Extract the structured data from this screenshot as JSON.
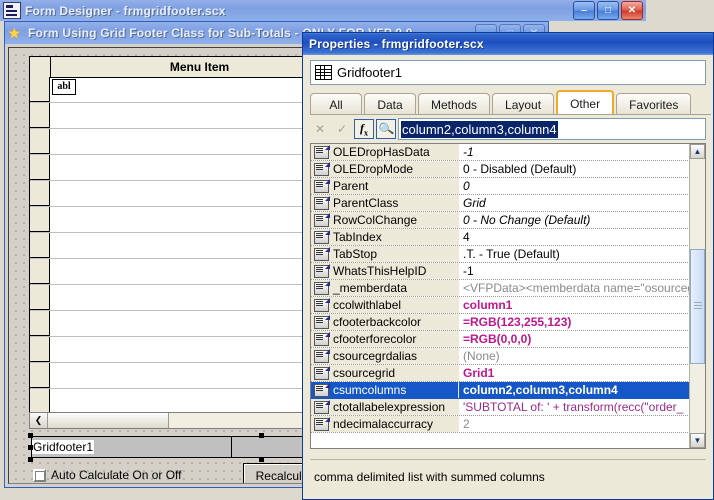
{
  "form_designer_window": {
    "title": "Form Designer - frmgridfooter.scx",
    "icon": "form-designer-icon",
    "buttons": {
      "minimize": "–",
      "maximize": "□",
      "close": "✕"
    }
  },
  "form_window": {
    "title": "Form Using Grid Footer Class for Sub-Totals - ONLY FOR VFP 9.0",
    "icon": "vfp-star-icon",
    "buttons": {
      "minimize": "–",
      "maximize": "□",
      "close": "✕"
    },
    "grid": {
      "headers": [
        "",
        "Menu Item",
        "",
        ""
      ],
      "textbox_glyph": "abl",
      "row_count": 13
    },
    "hscrollbar": {
      "left_arrow": "❮"
    },
    "footer_strip": {
      "label": "Gridfooter1"
    },
    "checkbox": {
      "label": "Auto Calculate On or Off",
      "checked": false
    },
    "recalc_button": {
      "label": "Recalculate",
      "accel": "R"
    }
  },
  "properties_window": {
    "title": "Properties - frmgridfooter.scx",
    "buttons": {
      "minimize": "–",
      "maximize": "□",
      "close": "✕"
    },
    "object_box": {
      "icon": "grid-icon",
      "value": "Gridfooter1"
    },
    "tabs": [
      {
        "label": "All",
        "active": false
      },
      {
        "label": "Data",
        "active": false
      },
      {
        "label": "Methods",
        "active": false
      },
      {
        "label": "Layout",
        "active": false
      },
      {
        "label": "Other",
        "active": true
      },
      {
        "label": "Favorites",
        "active": false
      }
    ],
    "toolbar": {
      "cancel": "✕",
      "accept": "✓",
      "function": "fx",
      "zoom": "search-icon"
    },
    "edit_field": {
      "value": "column2,column3,column4",
      "selected": true
    },
    "properties": [
      {
        "name": "OLEDropHasData",
        "value": "-1",
        "style": "v-default"
      },
      {
        "name": "OLEDropMode",
        "value": "0 - Disabled (Default)",
        "style": "v-plain"
      },
      {
        "name": "Parent",
        "value": "0",
        "style": "v-default"
      },
      {
        "name": "ParentClass",
        "value": "Grid",
        "style": "v-default"
      },
      {
        "name": "RowColChange",
        "value": "0 - No Change (Default)",
        "style": "v-default"
      },
      {
        "name": "TabIndex",
        "value": "4",
        "style": "v-plain"
      },
      {
        "name": "TabStop",
        "value": ".T. - True (Default)",
        "style": "v-plain"
      },
      {
        "name": "WhatsThisHelpID",
        "value": "-1",
        "style": "v-plain"
      },
      {
        "name": "_memberdata",
        "value": "<VFPData><memberdata name=\"osourceg",
        "style": "v-gray"
      },
      {
        "name": "ccolwithlabel",
        "value": "column1",
        "style": "v-magenta"
      },
      {
        "name": "cfooterbackcolor",
        "value": "=RGB(123,255,123)",
        "style": "v-magenta"
      },
      {
        "name": "cfooterforecolor",
        "value": "=RGB(0,0,0)",
        "style": "v-magenta"
      },
      {
        "name": "csourcegrdalias",
        "value": "(None)",
        "style": "v-gray"
      },
      {
        "name": "csourcegrid",
        "value": "Grid1",
        "style": "v-magenta"
      },
      {
        "name": "csumcolumns",
        "value": "column2,column3,column4",
        "style": "selected"
      },
      {
        "name": "ctotallabelexpression",
        "value": "'SUBTOTAL of: ' + transform(recc(\"order_",
        "style": "v-purple"
      },
      {
        "name": "ndecimalaccurracy",
        "value": "2",
        "style": "v-gray"
      }
    ],
    "scrollbar": {
      "up_arrow": "▲",
      "down_arrow": "▼"
    },
    "description": "comma delimited list with summed columns"
  }
}
